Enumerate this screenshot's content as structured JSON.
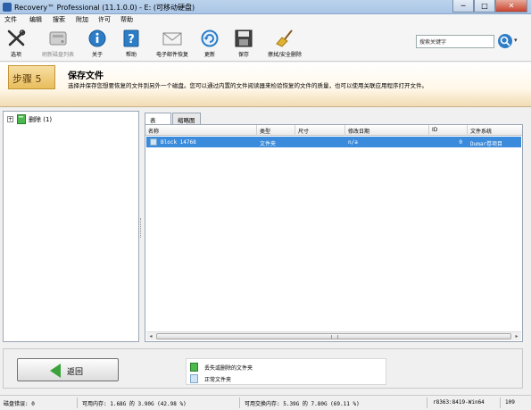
{
  "window": {
    "title": "Recovery™ Professional (11.1.0.0) - E: (可移动硬盘)",
    "minimize": "─",
    "maximize": "□",
    "close": "✕"
  },
  "menu": [
    "文件",
    "编辑",
    "搜索",
    "附加",
    "许可",
    "帮助"
  ],
  "toolbar": {
    "items": [
      {
        "label": "选项",
        "icon": "wrench-icon"
      },
      {
        "label": "刷新磁盘列表",
        "icon": "disk-icon"
      },
      {
        "label": "关于",
        "icon": "info-icon"
      },
      {
        "label": "帮助",
        "icon": "help-icon"
      },
      {
        "label": "电子邮件恢复",
        "icon": "envelope-icon"
      },
      {
        "label": "更新",
        "icon": "update-icon"
      },
      {
        "label": "保存",
        "icon": "floppy-icon"
      },
      {
        "label": "擦拭/安全删除",
        "icon": "broom-icon"
      }
    ],
    "search_value": "搜索关键字",
    "search_dropdown": "▾"
  },
  "step": {
    "label": "步骤 5",
    "title": "保存文件",
    "description": "选择并保存您想要恢复的文件到另外一个磁盘。您可以通过内置的文件阅读器来检验恢复的文件的质量，也可以使用关联应用程序打开文件。"
  },
  "tree": {
    "expander": "+",
    "item_label": "删除 (1)"
  },
  "tabs": [
    "表",
    "缩略图"
  ],
  "table": {
    "columns": [
      "名称",
      "类型",
      "尺寸",
      "修改日期",
      "ID",
      "文件系统"
    ],
    "rows": [
      {
        "name": "Block 14768",
        "type": "文件夹",
        "size": "",
        "modified": "n/a",
        "id": "0",
        "fs": "Dumar卷项目"
      }
    ]
  },
  "scroll": {
    "left": "◂",
    "right": "▸"
  },
  "back_button": "返回",
  "legend": [
    {
      "label": "丢失或删除的文件夹"
    },
    {
      "label": "正常文件夹"
    }
  ],
  "status": {
    "disk_errors": "磁盘错误: 0",
    "memory": "可用内存: 1.68G 的 3.90G (42.98 %)",
    "swap": "可用交换内存: 5.39G 的 7.80G (69.11 %)",
    "build": "r8363:8419-Win64",
    "extra": "109"
  },
  "colors": {
    "selection": "#3a8bdc",
    "accent": "#2d7dc6",
    "banner": "#f1dcb3"
  }
}
